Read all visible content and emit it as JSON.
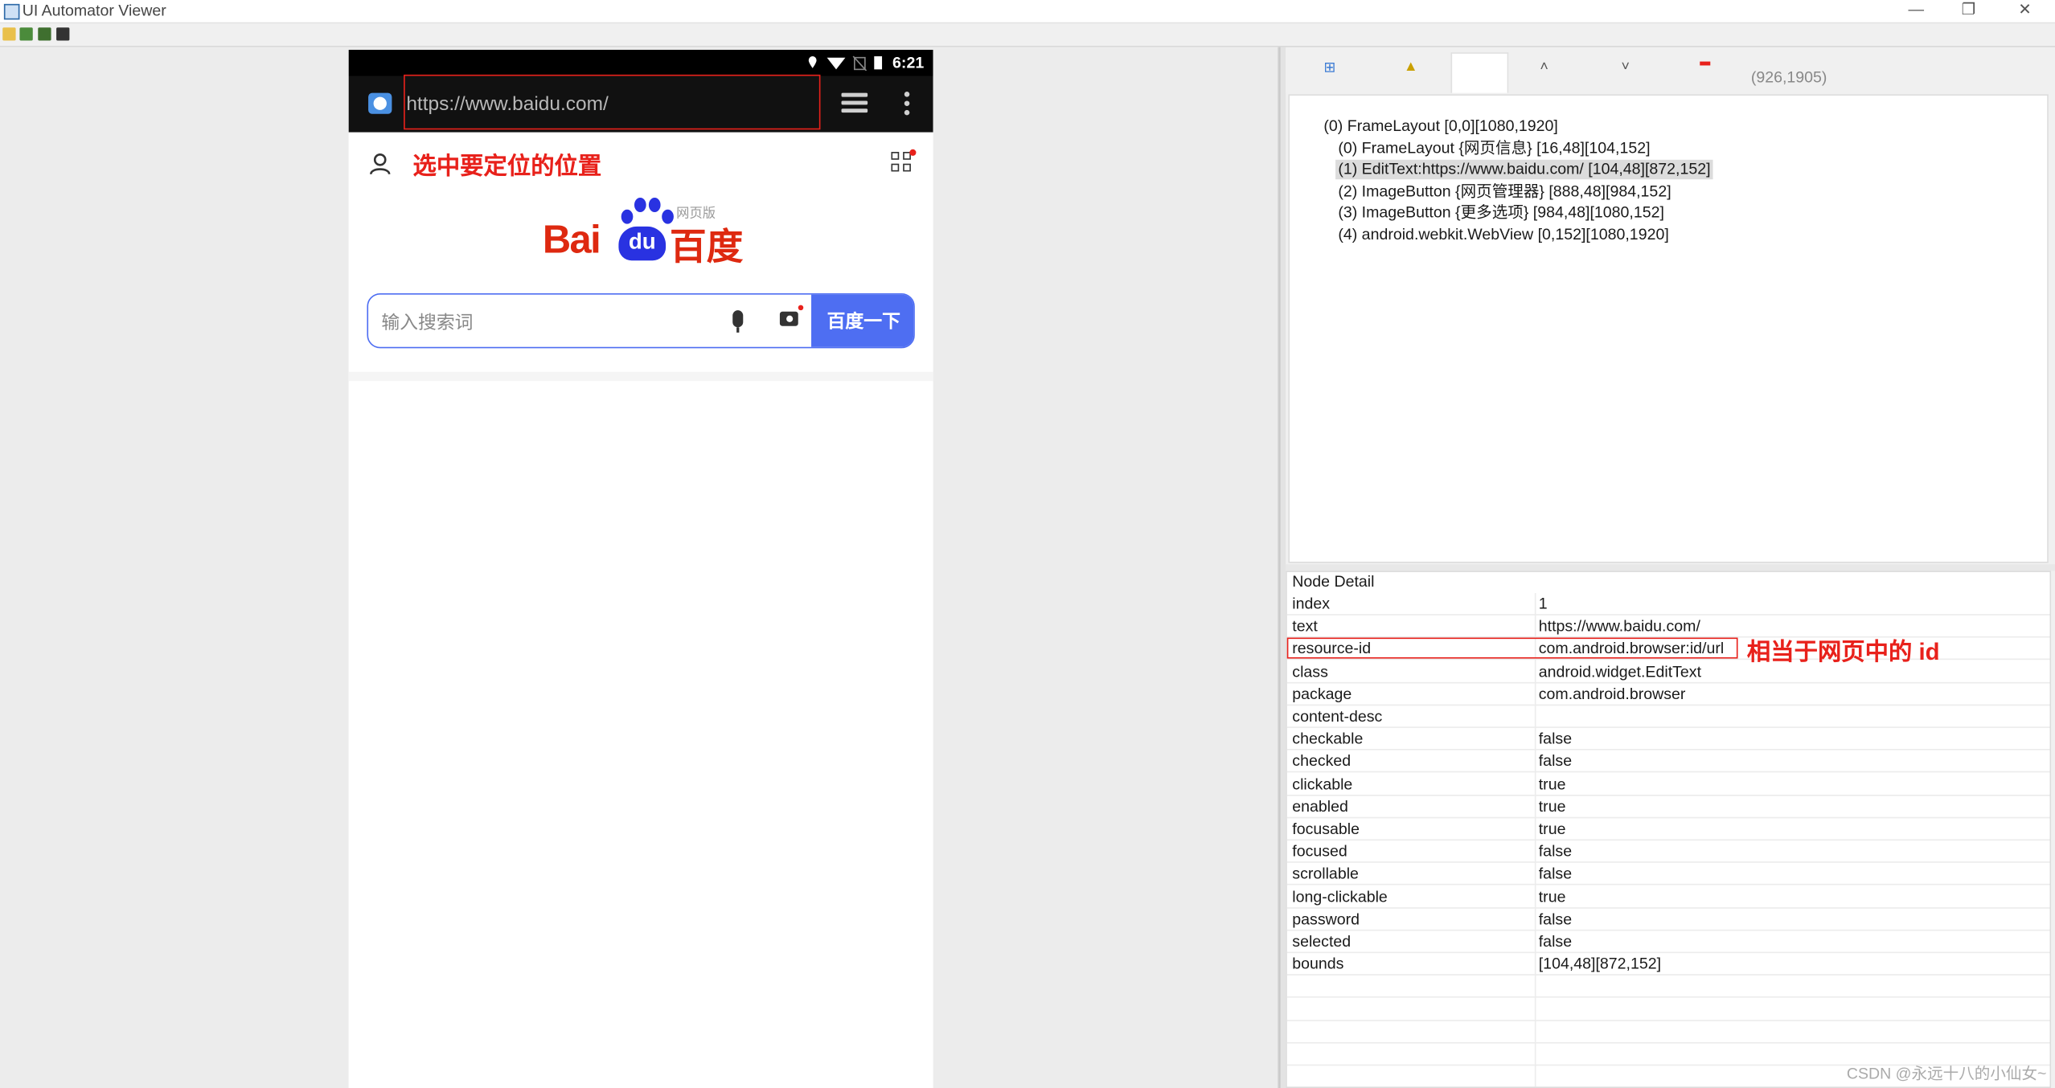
{
  "window": {
    "title": "UI Automator Viewer",
    "controls": [
      "—",
      "❐",
      "✕"
    ]
  },
  "phone": {
    "status_time": "6:21",
    "url": "https://www.baidu.com/",
    "annotation": "选中要定位的位置",
    "logo": {
      "latin": "Bai",
      "du": "du",
      "chinese": "百度",
      "sub": "网页版"
    },
    "search_placeholder": "输入搜索词",
    "search_button": "百度一下"
  },
  "rightpane": {
    "coords": "(926,1905)",
    "tree": [
      "(0) FrameLayout [0,0][1080,1920]",
      "(0) FrameLayout {网页信息} [16,48][104,152]",
      "(1) EditText:https://www.baidu.com/ [104,48][872,152]",
      "(2) ImageButton {网页管理器} [888,48][984,152]",
      "(3) ImageButton {更多选项} [984,48][1080,152]",
      "(4) android.webkit.WebView [0,152][1080,1920]"
    ],
    "detail_title": "Node Detail",
    "detail": [
      [
        "index",
        "1"
      ],
      [
        "text",
        "https://www.baidu.com/"
      ],
      [
        "resource-id",
        "com.android.browser:id/url"
      ],
      [
        "class",
        "android.widget.EditText"
      ],
      [
        "package",
        "com.android.browser"
      ],
      [
        "content-desc",
        ""
      ],
      [
        "checkable",
        "false"
      ],
      [
        "checked",
        "false"
      ],
      [
        "clickable",
        "true"
      ],
      [
        "enabled",
        "true"
      ],
      [
        "focusable",
        "true"
      ],
      [
        "focused",
        "false"
      ],
      [
        "scrollable",
        "false"
      ],
      [
        "long-clickable",
        "true"
      ],
      [
        "password",
        "false"
      ],
      [
        "selected",
        "false"
      ],
      [
        "bounds",
        "[104,48][872,152]"
      ]
    ],
    "annotation": "相当于网页中的 id"
  },
  "watermark": "CSDN @永远十八的小仙女~",
  "colors": {
    "annotation_red": "#e8211b",
    "baidu_blue": "#4e6ef2",
    "baidu_red": "#de2910"
  }
}
